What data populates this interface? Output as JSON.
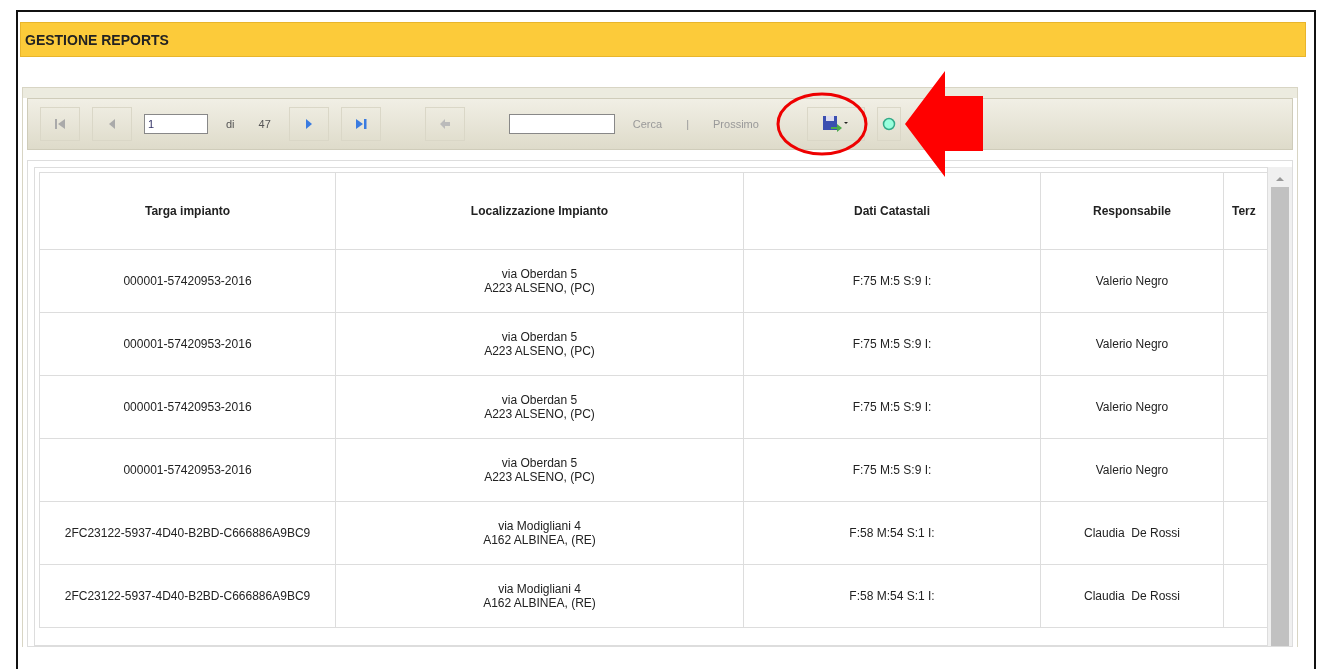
{
  "title": "GESTIONE REPORTS",
  "toolbar": {
    "page": "1",
    "of_label": "di",
    "total": "47",
    "find_label": "Cerca",
    "separator": "|",
    "next_label": "Prossimo"
  },
  "table": {
    "columns": [
      "Targa impianto",
      "Localizzazione Impianto",
      "Dati Catastali",
      "Responsabile",
      "Terz"
    ],
    "rows": [
      {
        "targa": "000001-57420953-2016",
        "address": "via Oberdan 5",
        "city": "A223 ALSENO, (PC)",
        "catasto": "F:75 M:5 S:9 I:",
        "responsabile": "Valerio Negro"
      },
      {
        "targa": "000001-57420953-2016",
        "address": "via Oberdan 5",
        "city": "A223 ALSENO, (PC)",
        "catasto": "F:75 M:5 S:9 I:",
        "responsabile": "Valerio Negro"
      },
      {
        "targa": "000001-57420953-2016",
        "address": "via Oberdan 5",
        "city": "A223 ALSENO, (PC)",
        "catasto": "F:75 M:5 S:9 I:",
        "responsabile": "Valerio Negro"
      },
      {
        "targa": "000001-57420953-2016",
        "address": "via Oberdan 5",
        "city": "A223 ALSENO, (PC)",
        "catasto": "F:75 M:5 S:9 I:",
        "responsabile": "Valerio Negro"
      },
      {
        "targa": "2FC23122-5937-4D40-B2BD-C666886A9BC9",
        "address": "via Modigliani 4",
        "city": "A162 ALBINEA, (RE)",
        "catasto": "F:58 M:54 S:1 I:",
        "responsabile": "Claudia  De Rossi"
      },
      {
        "targa": "2FC23122-5937-4D40-B2BD-C666886A9BC9",
        "address": "via Modigliani 4",
        "city": "A162 ALBINEA, (RE)",
        "catasto": "F:58 M:54 S:1 I:",
        "responsabile": "Claudia  De Rossi"
      }
    ]
  }
}
